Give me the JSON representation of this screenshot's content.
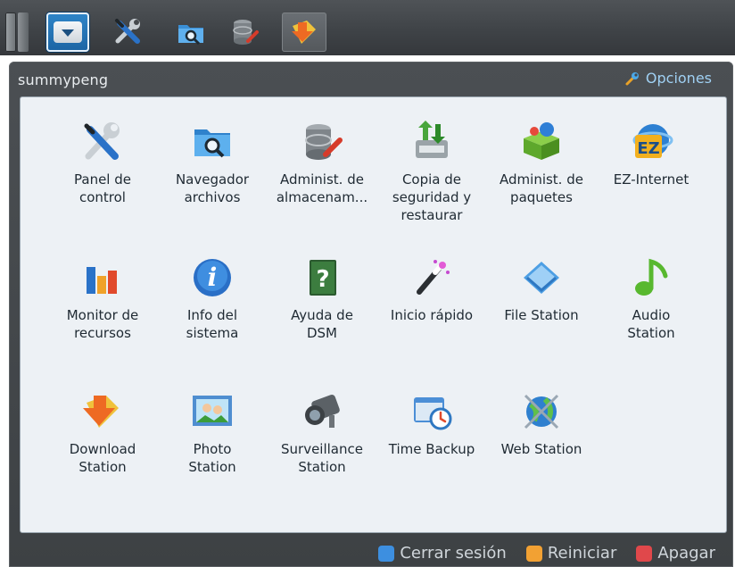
{
  "taskbar": {
    "buttons": [
      {
        "name": "main-menu",
        "icon": "chevron-down-icon"
      },
      {
        "name": "panel-control",
        "icon": "wrench-screwdriver-icon"
      },
      {
        "name": "file-browser",
        "icon": "folder-search-icon"
      },
      {
        "name": "storage-manager",
        "icon": "database-icon"
      },
      {
        "name": "download-station",
        "icon": "download-arrow-icon",
        "active": true
      }
    ]
  },
  "header": {
    "user": "summypeng",
    "options_label": "Opciones",
    "options_icon": "wrench-icon"
  },
  "apps": [
    {
      "label": "Panel de\ncontrol",
      "icon": "control-panel-icon"
    },
    {
      "label": "Navegador\narchivos",
      "icon": "folder-search-icon"
    },
    {
      "label": "Administ. de\nalmacenam...",
      "icon": "storage-icon"
    },
    {
      "label": "Copia de\nseguridad y\nrestaurar",
      "icon": "backup-restore-icon"
    },
    {
      "label": "Administ. de\npaquetes",
      "icon": "package-icon"
    },
    {
      "label": "EZ-Internet",
      "icon": "ez-internet-icon"
    },
    {
      "label": "Monitor de\nrecursos",
      "icon": "resource-monitor-icon"
    },
    {
      "label": "Info del\nsistema",
      "icon": "info-icon"
    },
    {
      "label": "Ayuda de\nDSM",
      "icon": "help-book-icon"
    },
    {
      "label": "Inicio rápido",
      "icon": "magic-wand-icon"
    },
    {
      "label": "File Station",
      "icon": "file-station-icon"
    },
    {
      "label": "Audio\nStation",
      "icon": "music-note-icon"
    },
    {
      "label": "Download\nStation",
      "icon": "download-arrow-icon"
    },
    {
      "label": "Photo\nStation",
      "icon": "photo-icon"
    },
    {
      "label": "Surveillance\nStation",
      "icon": "camera-icon"
    },
    {
      "label": "Time Backup",
      "icon": "time-backup-icon"
    },
    {
      "label": "Web Station",
      "icon": "web-globe-icon"
    }
  ],
  "footer": {
    "logout_label": "Cerrar sesión",
    "restart_label": "Reiniciar",
    "shutdown_label": "Apagar",
    "colors": {
      "logout": "#3d8fe0",
      "restart": "#f2a133",
      "shutdown": "#e0484b"
    }
  }
}
